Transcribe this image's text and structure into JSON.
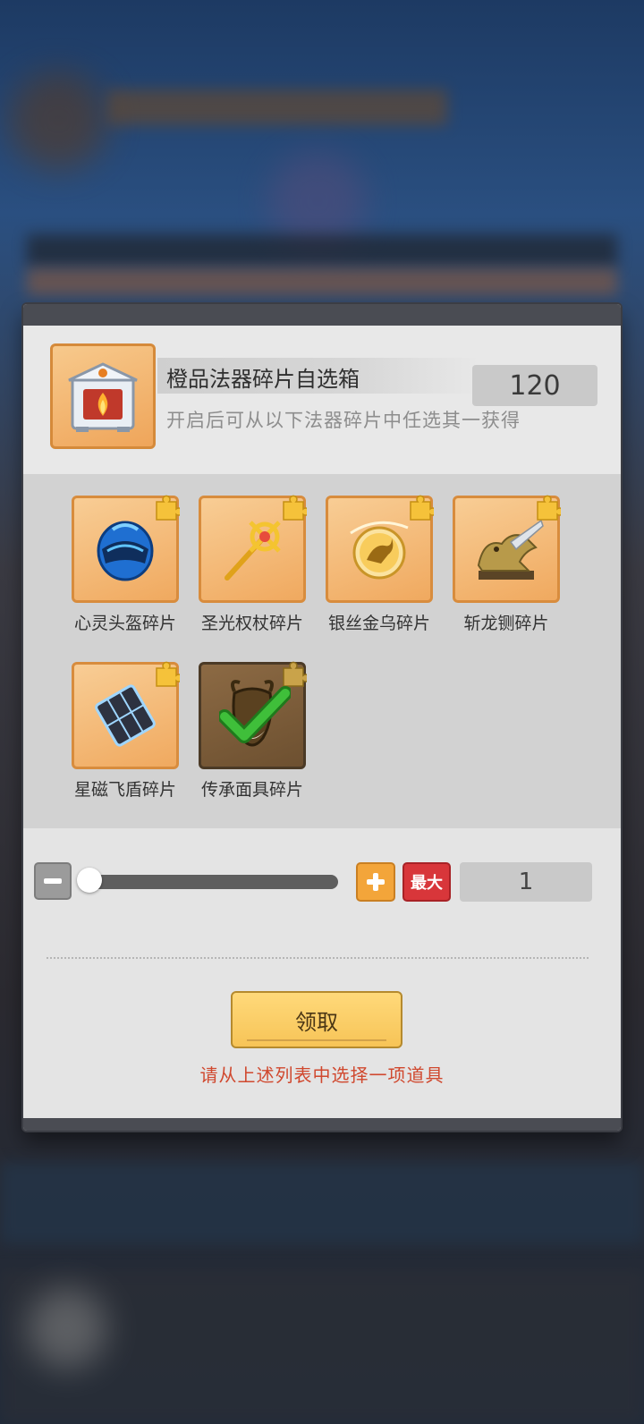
{
  "box": {
    "title": "橙品法器碎片自选箱",
    "description": "开启后可从以下法器碎片中任选其一获得",
    "owned_count": "120",
    "icon": "treasure-chest-icon"
  },
  "items": [
    {
      "label": "心灵头盔碎片",
      "icon": "helmet-icon",
      "selected": false
    },
    {
      "label": "圣光权杖碎片",
      "icon": "scepter-icon",
      "selected": false
    },
    {
      "label": "银丝金乌碎片",
      "icon": "golden-crow-orb-icon",
      "selected": false
    },
    {
      "label": "斩龙铡碎片",
      "icon": "dragon-guillotine-icon",
      "selected": false
    },
    {
      "label": "星磁飞盾碎片",
      "icon": "shield-icon",
      "selected": false
    },
    {
      "label": "传承面具碎片",
      "icon": "mask-icon",
      "selected": true
    }
  ],
  "quantity": {
    "max_label": "最大",
    "value": "1",
    "slider_fraction": 0
  },
  "claim_button": "领取",
  "hint": "请从上述列表中选择一项道具",
  "colors": {
    "card_orange": "#f0a95f",
    "hint_red": "#d0482e",
    "max_red": "#d8363a",
    "plus_orange": "#f3a53a",
    "claim_yellow": "#f7c457",
    "check_green": "#3fbf3a"
  }
}
